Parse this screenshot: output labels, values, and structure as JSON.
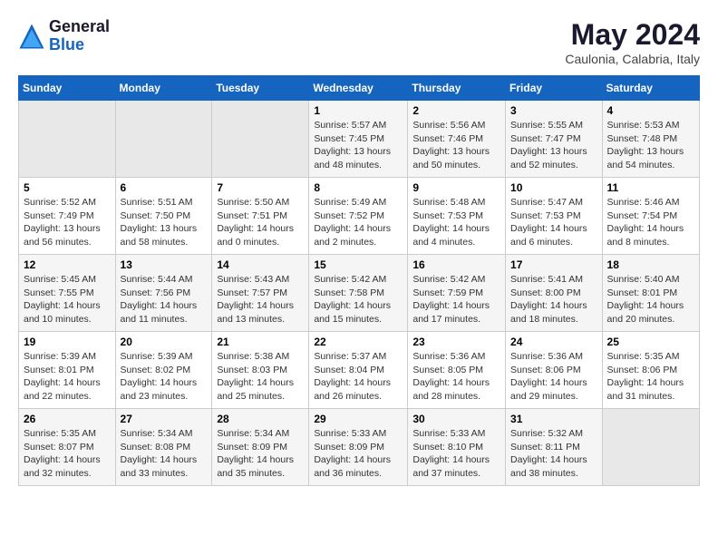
{
  "header": {
    "logo_line1": "General",
    "logo_line2": "Blue",
    "month": "May 2024",
    "location": "Caulonia, Calabria, Italy"
  },
  "weekdays": [
    "Sunday",
    "Monday",
    "Tuesday",
    "Wednesday",
    "Thursday",
    "Friday",
    "Saturday"
  ],
  "weeks": [
    [
      {
        "day": "",
        "info": ""
      },
      {
        "day": "",
        "info": ""
      },
      {
        "day": "",
        "info": ""
      },
      {
        "day": "1",
        "info": "Sunrise: 5:57 AM\nSunset: 7:45 PM\nDaylight: 13 hours\nand 48 minutes."
      },
      {
        "day": "2",
        "info": "Sunrise: 5:56 AM\nSunset: 7:46 PM\nDaylight: 13 hours\nand 50 minutes."
      },
      {
        "day": "3",
        "info": "Sunrise: 5:55 AM\nSunset: 7:47 PM\nDaylight: 13 hours\nand 52 minutes."
      },
      {
        "day": "4",
        "info": "Sunrise: 5:53 AM\nSunset: 7:48 PM\nDaylight: 13 hours\nand 54 minutes."
      }
    ],
    [
      {
        "day": "5",
        "info": "Sunrise: 5:52 AM\nSunset: 7:49 PM\nDaylight: 13 hours\nand 56 minutes."
      },
      {
        "day": "6",
        "info": "Sunrise: 5:51 AM\nSunset: 7:50 PM\nDaylight: 13 hours\nand 58 minutes."
      },
      {
        "day": "7",
        "info": "Sunrise: 5:50 AM\nSunset: 7:51 PM\nDaylight: 14 hours\nand 0 minutes."
      },
      {
        "day": "8",
        "info": "Sunrise: 5:49 AM\nSunset: 7:52 PM\nDaylight: 14 hours\nand 2 minutes."
      },
      {
        "day": "9",
        "info": "Sunrise: 5:48 AM\nSunset: 7:53 PM\nDaylight: 14 hours\nand 4 minutes."
      },
      {
        "day": "10",
        "info": "Sunrise: 5:47 AM\nSunset: 7:53 PM\nDaylight: 14 hours\nand 6 minutes."
      },
      {
        "day": "11",
        "info": "Sunrise: 5:46 AM\nSunset: 7:54 PM\nDaylight: 14 hours\nand 8 minutes."
      }
    ],
    [
      {
        "day": "12",
        "info": "Sunrise: 5:45 AM\nSunset: 7:55 PM\nDaylight: 14 hours\nand 10 minutes."
      },
      {
        "day": "13",
        "info": "Sunrise: 5:44 AM\nSunset: 7:56 PM\nDaylight: 14 hours\nand 11 minutes."
      },
      {
        "day": "14",
        "info": "Sunrise: 5:43 AM\nSunset: 7:57 PM\nDaylight: 14 hours\nand 13 minutes."
      },
      {
        "day": "15",
        "info": "Sunrise: 5:42 AM\nSunset: 7:58 PM\nDaylight: 14 hours\nand 15 minutes."
      },
      {
        "day": "16",
        "info": "Sunrise: 5:42 AM\nSunset: 7:59 PM\nDaylight: 14 hours\nand 17 minutes."
      },
      {
        "day": "17",
        "info": "Sunrise: 5:41 AM\nSunset: 8:00 PM\nDaylight: 14 hours\nand 18 minutes."
      },
      {
        "day": "18",
        "info": "Sunrise: 5:40 AM\nSunset: 8:01 PM\nDaylight: 14 hours\nand 20 minutes."
      }
    ],
    [
      {
        "day": "19",
        "info": "Sunrise: 5:39 AM\nSunset: 8:01 PM\nDaylight: 14 hours\nand 22 minutes."
      },
      {
        "day": "20",
        "info": "Sunrise: 5:39 AM\nSunset: 8:02 PM\nDaylight: 14 hours\nand 23 minutes."
      },
      {
        "day": "21",
        "info": "Sunrise: 5:38 AM\nSunset: 8:03 PM\nDaylight: 14 hours\nand 25 minutes."
      },
      {
        "day": "22",
        "info": "Sunrise: 5:37 AM\nSunset: 8:04 PM\nDaylight: 14 hours\nand 26 minutes."
      },
      {
        "day": "23",
        "info": "Sunrise: 5:36 AM\nSunset: 8:05 PM\nDaylight: 14 hours\nand 28 minutes."
      },
      {
        "day": "24",
        "info": "Sunrise: 5:36 AM\nSunset: 8:06 PM\nDaylight: 14 hours\nand 29 minutes."
      },
      {
        "day": "25",
        "info": "Sunrise: 5:35 AM\nSunset: 8:06 PM\nDaylight: 14 hours\nand 31 minutes."
      }
    ],
    [
      {
        "day": "26",
        "info": "Sunrise: 5:35 AM\nSunset: 8:07 PM\nDaylight: 14 hours\nand 32 minutes."
      },
      {
        "day": "27",
        "info": "Sunrise: 5:34 AM\nSunset: 8:08 PM\nDaylight: 14 hours\nand 33 minutes."
      },
      {
        "day": "28",
        "info": "Sunrise: 5:34 AM\nSunset: 8:09 PM\nDaylight: 14 hours\nand 35 minutes."
      },
      {
        "day": "29",
        "info": "Sunrise: 5:33 AM\nSunset: 8:09 PM\nDaylight: 14 hours\nand 36 minutes."
      },
      {
        "day": "30",
        "info": "Sunrise: 5:33 AM\nSunset: 8:10 PM\nDaylight: 14 hours\nand 37 minutes."
      },
      {
        "day": "31",
        "info": "Sunrise: 5:32 AM\nSunset: 8:11 PM\nDaylight: 14 hours\nand 38 minutes."
      },
      {
        "day": "",
        "info": ""
      }
    ]
  ]
}
